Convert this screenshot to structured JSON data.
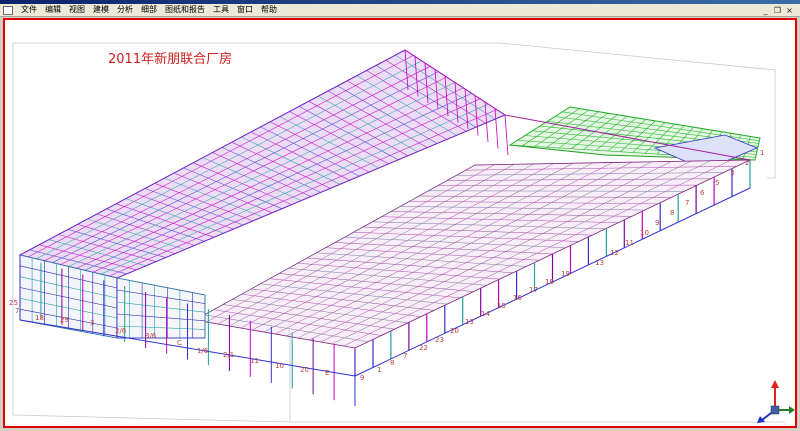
{
  "menu": {
    "items": [
      {
        "label": "文件",
        "name": "menu-file"
      },
      {
        "label": "编辑",
        "name": "menu-edit"
      },
      {
        "label": "视图",
        "name": "menu-view"
      },
      {
        "label": "建模",
        "name": "menu-modeling"
      },
      {
        "label": "分析",
        "name": "menu-analysis"
      },
      {
        "label": "细部",
        "name": "menu-detailing"
      },
      {
        "label": "图纸和报告",
        "name": "menu-drawings-reports"
      },
      {
        "label": "工具",
        "name": "menu-tools"
      },
      {
        "label": "窗口",
        "name": "menu-window"
      },
      {
        "label": "帮助",
        "name": "menu-help"
      }
    ]
  },
  "window_controls": {
    "minimize_icon": "_",
    "restore_icon": "❐",
    "close_icon": "×"
  },
  "viewport": {
    "project_title": "2011年新朋联合厂房",
    "grid_labels_left": [
      "25",
      "7",
      "18",
      "29",
      "3",
      "2/6",
      "3/6",
      "C",
      "1/6",
      "2/1",
      "11"
    ],
    "grid_labels_bottom": [
      "10",
      "20",
      "E",
      "9",
      "1",
      "8",
      "7",
      "22",
      "23",
      "20",
      "13",
      "14",
      "15",
      "16",
      "17",
      "18",
      "19"
    ],
    "grid_labels_right": [
      "1",
      "2",
      "3",
      "5",
      "6",
      "7",
      "8",
      "9",
      "10",
      "11",
      "12",
      "13"
    ],
    "colors": {
      "title": "#d02020",
      "frame_border": "#e00000",
      "member_magenta": "#c000c0",
      "member_blue": "#3030d0",
      "member_cyan": "#20a0a0",
      "member_green": "#20b020",
      "grid_label": "#c04040"
    },
    "axis_icon": "xyz-axis-triad-icon"
  }
}
